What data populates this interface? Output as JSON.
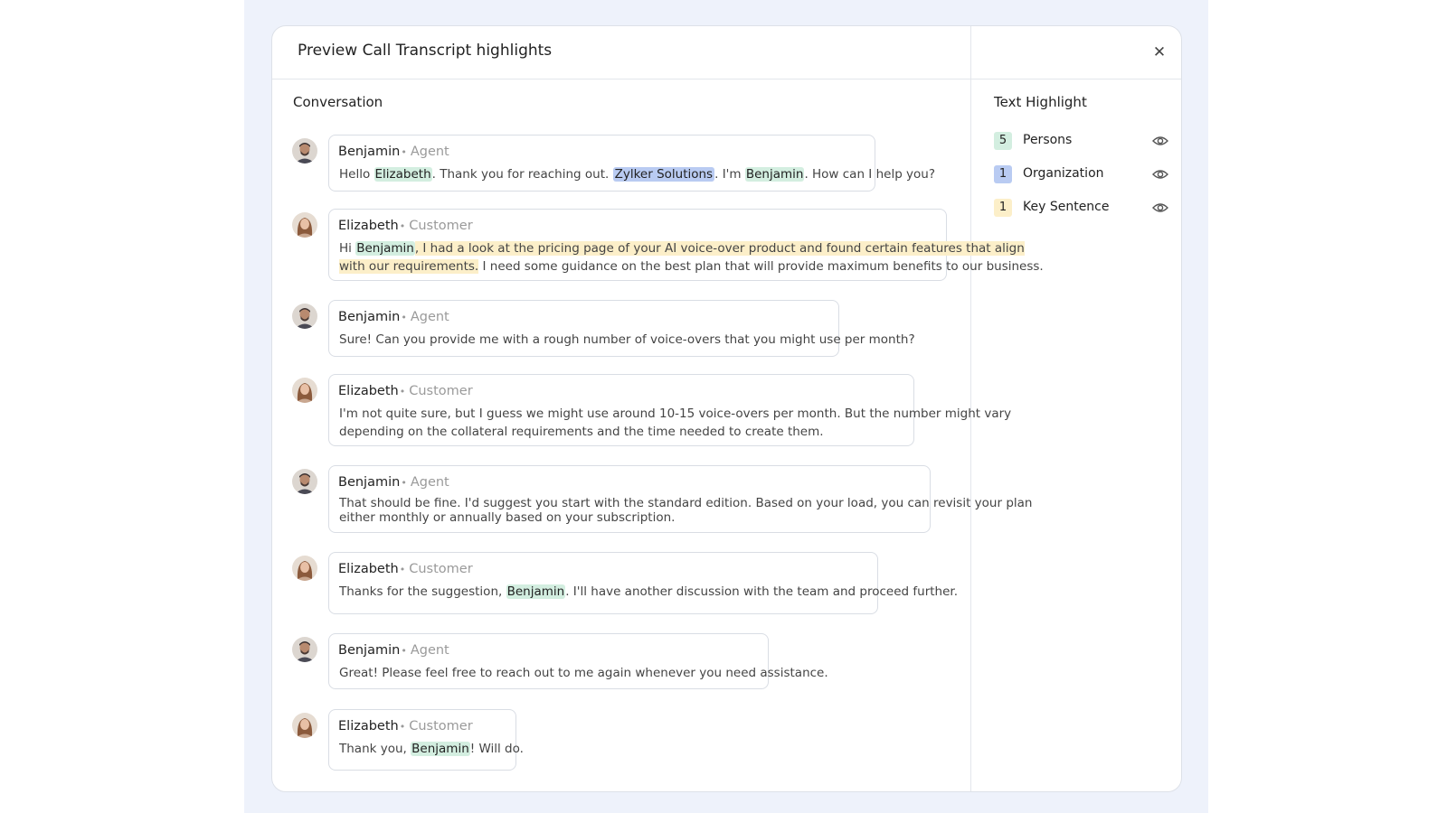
{
  "modal": {
    "title": "Preview Call Transcript highlights",
    "close_glyph": "✕",
    "conversation_title": "Conversation"
  },
  "messages": [
    {
      "speaker": "Benjamin",
      "role": "Agent",
      "avatar": "male",
      "segments": [
        {
          "t": "Hello "
        },
        {
          "t": "Elizabeth",
          "hl": "person"
        },
        {
          "t": ". Thank you for reaching out. "
        },
        {
          "t": "Zylker Solutions",
          "hl": "org"
        },
        {
          "t": ". I'm "
        },
        {
          "t": "Benjamin",
          "hl": "person"
        },
        {
          "t": ". How can I help you?"
        }
      ]
    },
    {
      "speaker": "Elizabeth",
      "role": "Customer",
      "avatar": "female",
      "segments": [
        {
          "t": "Hi "
        },
        {
          "t": "Benjamin",
          "hl": "person"
        },
        {
          "t": ", I had a look at the pricing page of your AI voice-over product and found certain features that align",
          "hl": "key"
        },
        {
          "br": true
        },
        {
          "t": "with our requirements.",
          "hl": "key"
        },
        {
          "t": " I need some guidance on the best plan that will provide maximum benefits to our business."
        }
      ]
    },
    {
      "speaker": "Benjamin",
      "role": "Agent",
      "avatar": "male",
      "segments": [
        {
          "t": "Sure! Can you provide me with a rough number of voice-overs that you might use per month?"
        }
      ]
    },
    {
      "speaker": "Elizabeth",
      "role": "Customer",
      "avatar": "female",
      "segments": [
        {
          "t": "I'm not quite sure, but I guess we might use around 10-15 voice-overs per month. But the number might vary"
        },
        {
          "br": true
        },
        {
          "t": "depending on the collateral requirements and the time needed to create them."
        }
      ]
    },
    {
      "speaker": "Benjamin",
      "role": "Agent",
      "avatar": "male",
      "segments": [
        {
          "t": "That should be fine. I'd suggest you start with the standard edition. Based on your load, you can revisit your plan"
        },
        {
          "br": true
        },
        {
          "t": "either monthly or annually based on your subscription."
        }
      ]
    },
    {
      "speaker": "Elizabeth",
      "role": "Customer",
      "avatar": "female",
      "segments": [
        {
          "t": "Thanks for the suggestion, "
        },
        {
          "t": "Benjamin",
          "hl": "person"
        },
        {
          "t": ". I'll have another discussion with the team and proceed further."
        }
      ]
    },
    {
      "speaker": "Benjamin",
      "role": "Agent",
      "avatar": "male",
      "segments": [
        {
          "t": "Great! Please feel free to reach out to me again whenever you need assistance."
        }
      ]
    },
    {
      "speaker": "Elizabeth",
      "role": "Customer",
      "avatar": "female",
      "segments": [
        {
          "t": "Thank you, "
        },
        {
          "t": "Benjamin",
          "hl": "person"
        },
        {
          "t": "! Will do."
        }
      ]
    }
  ],
  "sidebar": {
    "title": "Text Highlight",
    "items": [
      {
        "count": "5",
        "label": "Persons",
        "color": "#d3eee0",
        "icon": "eye-icon"
      },
      {
        "count": "1",
        "label": "Organization",
        "color": "#b9cbf2",
        "icon": "eye-icon"
      },
      {
        "count": "1",
        "label": "Key Sentence",
        "color": "#fcefc9",
        "icon": "eye-icon"
      }
    ]
  },
  "colors": {
    "person": "#d3eee0",
    "organization": "#b9cbf2",
    "key_sentence": "#fcefc9",
    "backdrop": "#eef2fb"
  }
}
